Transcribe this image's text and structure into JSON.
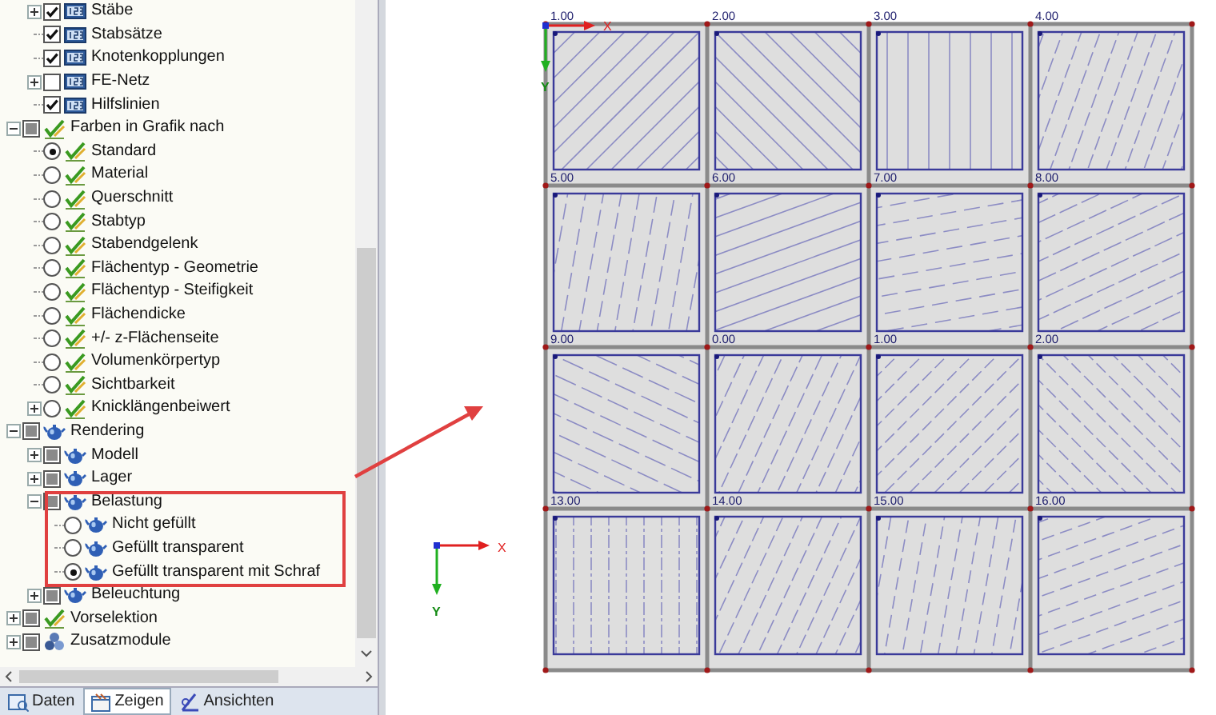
{
  "tree": [
    {
      "children": [
        {
          "label": "Stäbe",
          "expanded": false,
          "kind": "checkbox",
          "checked": true
        },
        {
          "label": "Stabsätze",
          "kind": "checkbox",
          "checked": true
        },
        {
          "label": "Knotenkopplungen",
          "kind": "checkbox",
          "checked": true
        },
        {
          "label": "FE-Netz",
          "expanded": false,
          "kind": "checkbox",
          "checked": false
        },
        {
          "label": "Hilfslinien",
          "kind": "checkbox",
          "checked": true
        }
      ]
    },
    {
      "label": "Farben in Grafik nach",
      "expanded": true,
      "kind": "checkbox",
      "partial": true,
      "children": [
        {
          "label": "Standard",
          "kind": "radio",
          "selected": true
        },
        {
          "label": "Material",
          "kind": "radio",
          "selected": false
        },
        {
          "label": "Querschnitt",
          "kind": "radio",
          "selected": false
        },
        {
          "label": "Stabtyp",
          "kind": "radio",
          "selected": false
        },
        {
          "label": "Stabendgelenk",
          "kind": "radio",
          "selected": false
        },
        {
          "label": "Flächentyp - Geometrie",
          "kind": "radio",
          "selected": false
        },
        {
          "label": "Flächentyp - Steifigkeit",
          "kind": "radio",
          "selected": false
        },
        {
          "label": "Flächendicke",
          "kind": "radio",
          "selected": false
        },
        {
          "label": "+/- z-Flächenseite",
          "kind": "radio",
          "selected": false
        },
        {
          "label": "Volumenkörpertyp",
          "kind": "radio",
          "selected": false
        },
        {
          "label": "Sichtbarkeit",
          "kind": "radio",
          "selected": false
        },
        {
          "label": "Knicklängenbeiwert",
          "expanded": false,
          "kind": "radio",
          "selected": false
        }
      ]
    },
    {
      "label": "Rendering",
      "expanded": true,
      "kind": "checkbox",
      "partial": true,
      "children": [
        {
          "label": "Modell",
          "expanded": false,
          "kind": "checkbox",
          "partial": true
        },
        {
          "label": "Lager",
          "expanded": false,
          "kind": "checkbox",
          "partial": true
        },
        {
          "label": "Belastung",
          "expanded": true,
          "highlighted": true,
          "kind": "checkbox",
          "partial": true,
          "children": [
            {
              "label": "Nicht gefüllt",
              "kind": "radio",
              "selected": false
            },
            {
              "label": "Gefüllt transparent",
              "kind": "radio",
              "selected": false
            },
            {
              "label": "Gefüllt transparent mit Schraf",
              "kind": "radio",
              "selected": true
            }
          ]
        },
        {
          "label": "Beleuchtung",
          "expanded": false,
          "kind": "checkbox",
          "partial": true
        }
      ]
    },
    {
      "label": "Vorselektion",
      "expanded": false,
      "kind": "checkbox",
      "partial": true
    },
    {
      "label": "Zusatzmodule",
      "expanded": false,
      "kind": "checkbox",
      "partial": true
    }
  ],
  "tabs": [
    {
      "label": "Daten",
      "selected": false
    },
    {
      "label": "Zeigen",
      "selected": true
    },
    {
      "label": "Ansichten",
      "selected": false
    }
  ],
  "canvas": {
    "origin_axes": {
      "x_label": "X",
      "y_label": "Y"
    },
    "panels": [
      {
        "label": "1.00"
      },
      {
        "label": "2.00"
      },
      {
        "label": "3.00"
      },
      {
        "label": "4.00"
      },
      {
        "label": "5.00"
      },
      {
        "label": "6.00"
      },
      {
        "label": "7.00"
      },
      {
        "label": "8.00"
      },
      {
        "label": "9.00"
      },
      {
        "label": "0.00"
      },
      {
        "label": "1.00"
      },
      {
        "label": "2.00"
      },
      {
        "label": "13.00"
      },
      {
        "label": "14.00"
      },
      {
        "label": "15.00"
      },
      {
        "label": "16.00"
      }
    ],
    "axis_indicator": {
      "x_label": "X",
      "y_label": "Y"
    }
  }
}
